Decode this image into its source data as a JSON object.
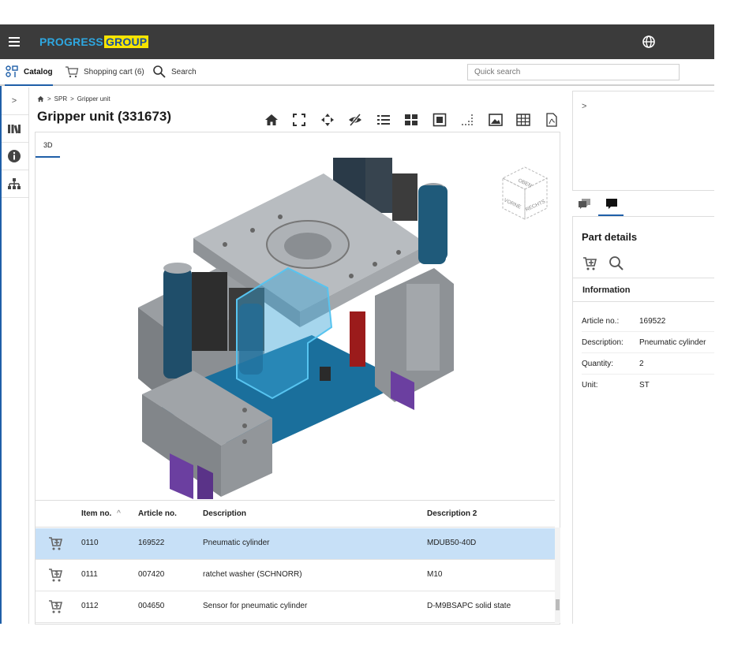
{
  "header": {
    "brand_part1": "PROGRESS",
    "brand_part2": "GROUP"
  },
  "nav": {
    "catalog": "Catalog",
    "cart": "Shopping cart (6)",
    "search": "Search",
    "quick_search_placeholder": "Quick search"
  },
  "breadcrumb": {
    "sep": ">",
    "items": [
      "SPR",
      "Gripper unit"
    ]
  },
  "page": {
    "title": "Gripper unit (331673)"
  },
  "viewer": {
    "tab_3d": "3D",
    "cube_labels": [
      "OBEN",
      "VORNE",
      "RECHTS"
    ]
  },
  "table": {
    "headers": [
      "Item no.",
      "Article no.",
      "Description",
      "Description 2"
    ],
    "sort_indicator": "^",
    "rows": [
      {
        "item": "0110",
        "article": "169522",
        "description": "Pneumatic cylinder",
        "description2": "MDUB50-40D",
        "selected": true
      },
      {
        "item": "0111",
        "article": "007420",
        "description": "ratchet washer (SCHNORR)",
        "description2": "M10",
        "selected": false
      },
      {
        "item": "0112",
        "article": "004650",
        "description": "Sensor for pneumatic cylinder",
        "description2": "D-M9BSAPC solid state",
        "selected": false
      }
    ]
  },
  "right_panel": {
    "collapse": ">",
    "part_details_title": "Part details",
    "information_header": "Information",
    "fields": [
      {
        "label": "Article no.:",
        "value": "169522"
      },
      {
        "label": "Description:",
        "value": "Pneumatic cylinder"
      },
      {
        "label": "Quantity:",
        "value": "2"
      },
      {
        "label": "Unit:",
        "value": "ST"
      }
    ]
  },
  "rail": {
    "toggle": ">"
  },
  "colors": {
    "topbar": "#3b3b3b",
    "accent": "#1f5fa8",
    "selected_row": "#c7e0f7",
    "brand_blue": "#2ea7e0",
    "brand_yellow": "#f7e400"
  },
  "icons": [
    "menu-icon",
    "globe-icon",
    "catalog-icon",
    "cart-icon",
    "search-icon",
    "home-icon",
    "fit-view-icon",
    "explode-icon",
    "hide-icon",
    "list-icon",
    "grid-icon",
    "frame-icon",
    "dots-icon",
    "image-icon",
    "table-icon",
    "pdf-icon",
    "library-icon",
    "info-icon",
    "tree-icon",
    "comments-icon",
    "chat-icon",
    "add-to-cart-icon"
  ]
}
